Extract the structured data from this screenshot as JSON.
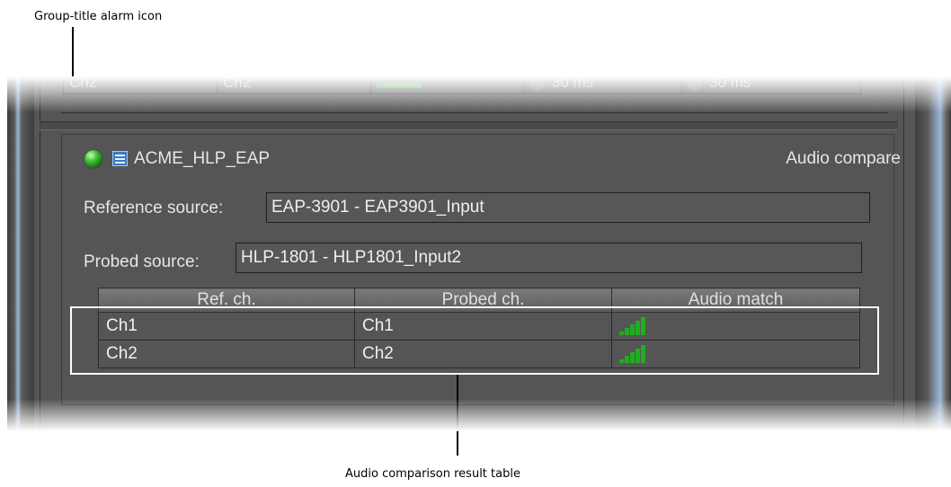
{
  "callouts": {
    "top": "Group-title alarm icon",
    "bottom": "Audio comparison result table"
  },
  "previous_group": {
    "row": [
      "Ch2",
      "Ch2",
      "",
      "30 ms",
      "30 ms"
    ]
  },
  "group": {
    "alarm_icon": "green-led-icon",
    "table_icon": "table-icon",
    "title": "ACME_HLP_EAP",
    "type": "Audio compare",
    "reference_label": "Reference source:",
    "reference_value": "EAP-3901 - EAP3901_Input",
    "probed_label": "Probed source:",
    "probed_value": "HLP-1801 - HLP1801_Input2"
  },
  "table": {
    "headers": [
      "Ref. ch.",
      "Probed ch.",
      "Audio match"
    ],
    "rows": [
      {
        "ref": "Ch1",
        "probed": "Ch1",
        "match_bars": 5,
        "match_level": 1.0
      },
      {
        "ref": "Ch2",
        "probed": "Ch2",
        "match_bars": 5,
        "match_level": 1.0
      }
    ]
  },
  "colors": {
    "panel_bg": "#555555",
    "led_green": "#2fbf2f",
    "match_bar": "#1fae1f",
    "highlight_border": "#ffffff"
  }
}
